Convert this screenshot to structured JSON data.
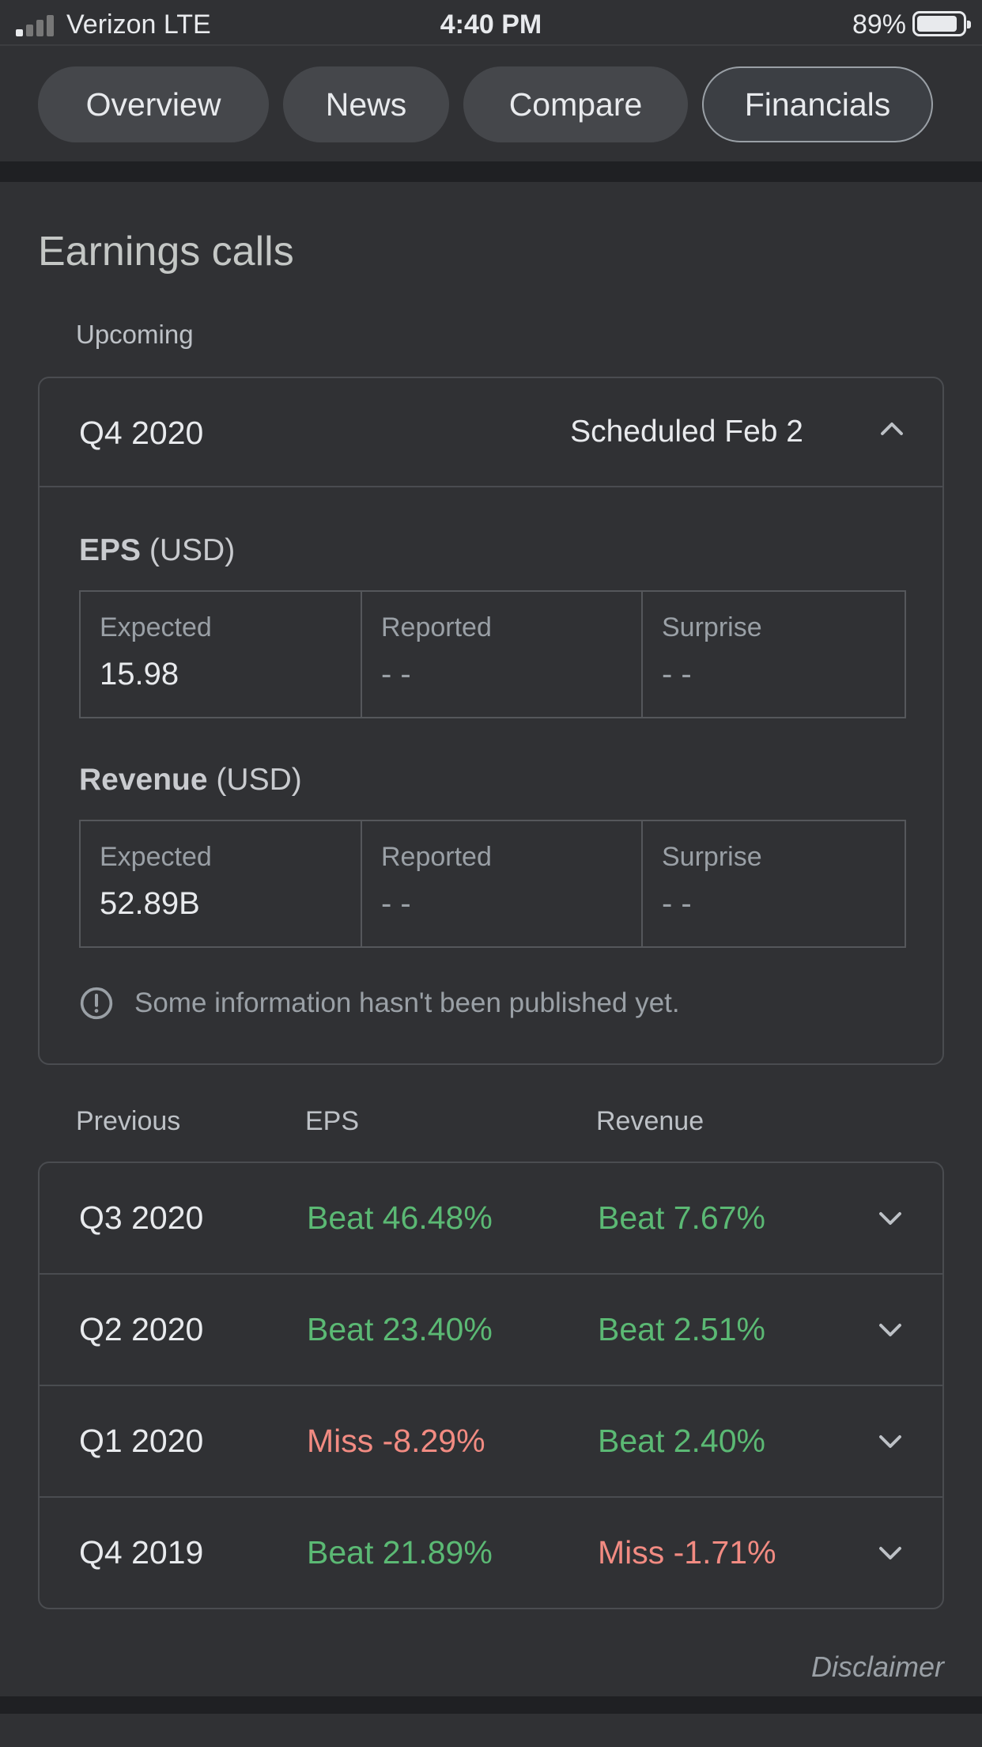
{
  "status_bar": {
    "carrier": "Verizon  LTE",
    "time": "4:40 PM",
    "battery_percent": "89%",
    "battery_level": 0.89,
    "signal_bars_on": 1,
    "signal_bars_total": 4
  },
  "tabs": [
    {
      "label": "Overview",
      "active": false
    },
    {
      "label": "News",
      "active": false
    },
    {
      "label": "Compare",
      "active": false
    },
    {
      "label": "Financials",
      "active": true
    }
  ],
  "earnings": {
    "title": "Earnings calls",
    "upcoming_label": "Upcoming",
    "upcoming": {
      "quarter": "Q4 2020",
      "scheduled": "Scheduled Feb 2",
      "eps": {
        "title": "EPS",
        "unit": "(USD)",
        "cells": [
          {
            "label": "Expected",
            "value": "15.98"
          },
          {
            "label": "Reported",
            "value": "- -"
          },
          {
            "label": "Surprise",
            "value": "- -"
          }
        ]
      },
      "revenue": {
        "title": "Revenue",
        "unit": "(USD)",
        "cells": [
          {
            "label": "Expected",
            "value": "52.89B"
          },
          {
            "label": "Reported",
            "value": "- -"
          },
          {
            "label": "Surprise",
            "value": "- -"
          }
        ]
      },
      "info_text": "Some information hasn't been published yet."
    },
    "previous_headers": {
      "previous": "Previous",
      "eps": "EPS",
      "revenue": "Revenue"
    },
    "previous": [
      {
        "quarter": "Q3 2020",
        "eps": "Beat 46.48%",
        "eps_status": "beat",
        "revenue": "Beat 7.67%",
        "revenue_status": "beat"
      },
      {
        "quarter": "Q2 2020",
        "eps": "Beat 23.40%",
        "eps_status": "beat",
        "revenue": "Beat 2.51%",
        "revenue_status": "beat"
      },
      {
        "quarter": "Q1 2020",
        "eps": "Miss -8.29%",
        "eps_status": "miss",
        "revenue": "Beat 2.40%",
        "revenue_status": "beat"
      },
      {
        "quarter": "Q4 2019",
        "eps": "Beat 21.89%",
        "eps_status": "beat",
        "revenue": "Miss -1.71%",
        "revenue_status": "miss"
      }
    ],
    "disclaimer": "Disclaimer"
  },
  "colors": {
    "background": "#303134",
    "beat": "#5bb974",
    "miss": "#f28b82",
    "muted_text": "#9aa0a6",
    "border": "#4a4c50"
  }
}
